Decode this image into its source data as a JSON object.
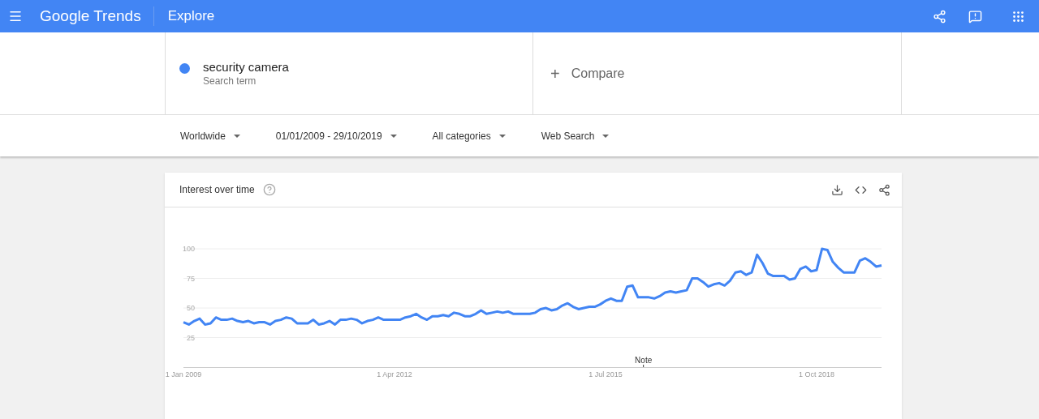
{
  "header": {
    "logo": "Google Trends",
    "section": "Explore"
  },
  "terms": [
    {
      "label": "security camera",
      "sublabel": "Search term",
      "color": "#4285f4"
    }
  ],
  "compare": {
    "label": "Compare",
    "icon": "+"
  },
  "filters": [
    {
      "label": "Worldwide"
    },
    {
      "label": "01/01/2009 - 29/10/2019"
    },
    {
      "label": "All categories"
    },
    {
      "label": "Web Search"
    }
  ],
  "card": {
    "title": "Interest over time",
    "chart_data": {
      "type": "line",
      "categories": [
        "1 Jan 2009",
        null,
        null,
        null,
        null,
        null,
        null,
        null,
        null,
        null,
        null,
        null,
        null,
        null,
        null,
        null,
        null,
        null,
        null,
        null,
        null,
        null,
        null,
        null,
        null,
        null,
        null,
        null,
        null,
        null,
        null,
        null,
        null,
        null,
        null,
        null,
        null,
        null,
        null,
        "1 Apr 2012",
        null,
        null,
        null,
        null,
        null,
        null,
        null,
        null,
        null,
        null,
        null,
        null,
        null,
        null,
        null,
        null,
        null,
        null,
        null,
        null,
        null,
        null,
        null,
        null,
        null,
        null,
        null,
        null,
        null,
        null,
        null,
        null,
        null,
        null,
        null,
        null,
        null,
        null,
        "1 Jul 2015",
        null,
        null,
        null,
        null,
        null,
        null,
        null,
        null,
        null,
        null,
        null,
        null,
        null,
        null,
        null,
        null,
        null,
        null,
        null,
        null,
        null,
        null,
        null,
        null,
        null,
        null,
        null,
        null,
        null,
        null,
        null,
        null,
        null,
        null,
        null,
        null,
        null,
        null,
        "1 Oct 2018",
        null,
        null,
        null,
        null,
        null,
        null,
        null,
        null,
        null,
        null,
        null,
        null
      ],
      "series": [
        {
          "color": "#4285f4",
          "values": [
            38,
            36,
            39,
            41,
            36,
            37,
            42,
            40,
            40,
            41,
            39,
            38,
            39,
            37,
            38,
            38,
            36,
            39,
            40,
            42,
            41,
            37,
            37,
            37,
            40,
            36,
            37,
            39,
            36,
            40,
            40,
            41,
            40,
            37,
            39,
            40,
            42,
            40,
            40,
            40,
            40,
            42,
            43,
            45,
            42,
            40,
            43,
            43,
            44,
            43,
            46,
            45,
            43,
            43,
            45,
            48,
            45,
            46,
            47,
            46,
            47,
            45,
            45,
            45,
            45,
            46,
            49,
            50,
            48,
            49,
            52,
            54,
            51,
            49,
            50,
            51,
            51,
            53,
            56,
            58,
            56,
            56,
            68,
            69,
            59,
            59,
            59,
            58,
            60,
            63,
            64,
            63,
            64,
            65,
            75,
            75,
            72,
            68,
            70,
            71,
            69,
            73,
            80,
            81,
            78,
            80,
            95,
            88,
            79,
            77,
            77,
            77,
            74,
            75,
            83,
            85,
            81,
            82,
            100,
            99,
            89,
            84,
            80,
            80,
            80,
            90,
            92,
            89,
            85,
            86
          ]
        }
      ],
      "ylim": [
        -43.84,
        164.4
      ],
      "yticks": [
        25,
        50,
        75,
        100
      ],
      "grid": true,
      "annotations": [
        "Note"
      ]
    }
  }
}
